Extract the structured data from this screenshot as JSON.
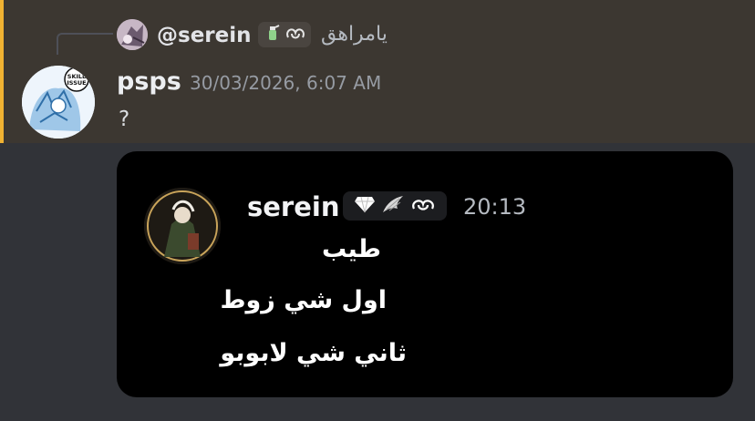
{
  "reply": {
    "username": "@serein",
    "preview_text": "يامراهق",
    "badge_icons": [
      "spray-bottle-icon",
      "pretzel-icon"
    ]
  },
  "message": {
    "author": "psps",
    "timestamp": "30/03/2026, 6:07 AM",
    "content": "?",
    "avatar_text": [
      "SKILL",
      "ISSUE"
    ]
  },
  "embed": {
    "username": "serein",
    "badge_icons": [
      "diamond-icon",
      "wing-icon",
      "pretzel-icon"
    ],
    "time": "20:13",
    "lines": [
      "طيب",
      "اول شي زوط",
      "ثاني شي لابوبو"
    ]
  },
  "colors": {
    "highlight_bar": "#f0b232",
    "background": "#313338",
    "embed_bg": "#000000"
  }
}
